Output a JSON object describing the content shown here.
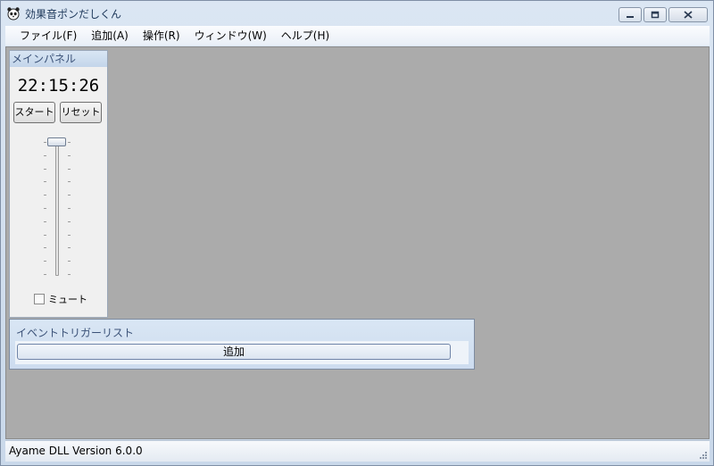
{
  "window": {
    "title": "効果音ポンだしくん",
    "icon": "panda-app-icon"
  },
  "menu": [
    {
      "id": "file",
      "label": "ファイル(F)"
    },
    {
      "id": "add",
      "label": "追加(A)"
    },
    {
      "id": "operate",
      "label": "操作(R)"
    },
    {
      "id": "window",
      "label": "ウィンドウ(W)"
    },
    {
      "id": "help",
      "label": "ヘルプ(H)"
    }
  ],
  "main_panel": {
    "caption": "メインパネル",
    "clock": "22:15:26",
    "start_label": "スタート",
    "reset_label": "リセット",
    "volume_fraction": 1.0,
    "mute_label": "ミュート",
    "mute_checked": false
  },
  "event_panel": {
    "caption": "イベントトリガーリスト",
    "add_label": "追加"
  },
  "status": {
    "text": "Ayame DLL Version 6.0.0"
  },
  "colors": {
    "mdi_background": "#ababab",
    "panel_caption": "#c3d5ea"
  }
}
